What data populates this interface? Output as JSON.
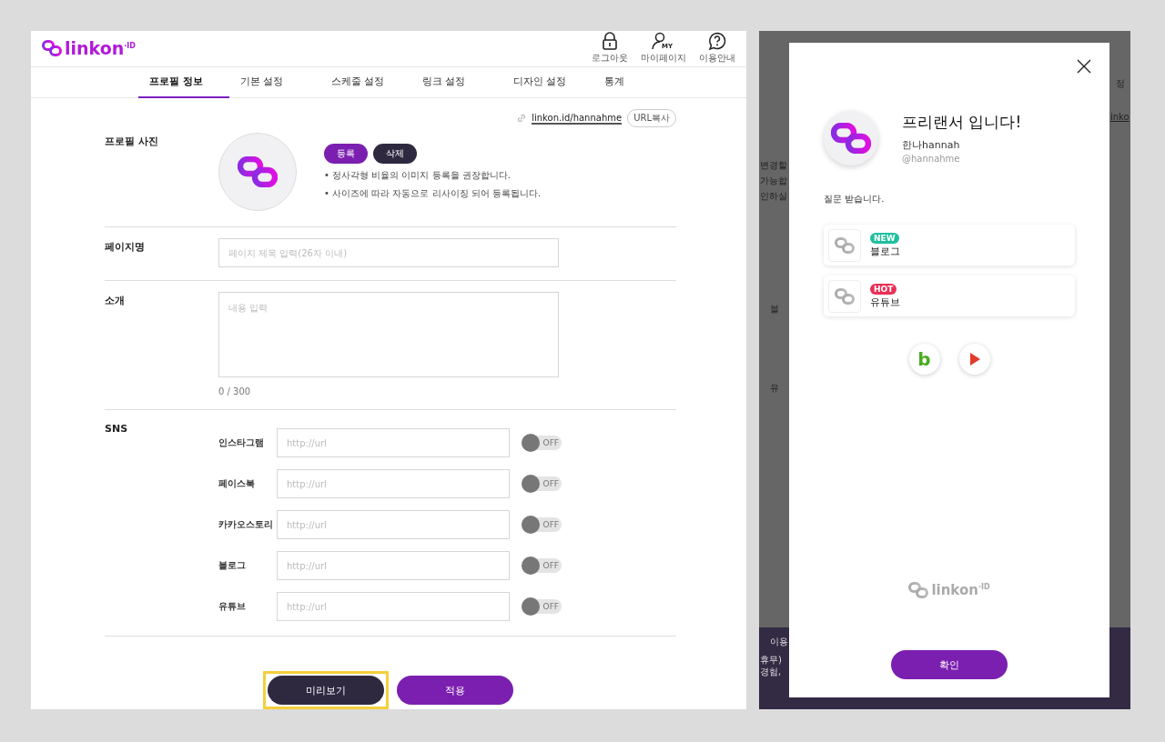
{
  "editor": {
    "logo": {
      "text": "linkon",
      "superscript": "·ID"
    },
    "header_actions": [
      {
        "label": "로그아웃",
        "kind": "lock"
      },
      {
        "label": "마이페이지",
        "kind": "my",
        "icon_text": "MY"
      },
      {
        "label": "이용안내",
        "kind": "help"
      }
    ],
    "tabs": [
      {
        "label": "프로필 정보",
        "selected": true
      },
      {
        "label": "기본 설정",
        "selected": false
      },
      {
        "label": "스케줄 설정",
        "selected": false
      },
      {
        "label": "링크 설정",
        "selected": false
      },
      {
        "label": "디자인 설정",
        "selected": false
      },
      {
        "label": "통계",
        "selected": false
      }
    ],
    "profile_link": {
      "url": "linkon.id/hannahme",
      "copy_button": "URL복사"
    },
    "profile_photo": {
      "label": "프로필 사진",
      "buttons": [
        {
          "label": "등록",
          "kind": "primary"
        },
        {
          "label": "삭제",
          "kind": "dark"
        }
      ],
      "notes": [
        "• 정사각형 비율의 이미지 등록을 권장합니다.",
        "• 사이즈에 따라 자동으로 리사이징 되어 등록됩니다."
      ]
    },
    "page_name": {
      "label": "페이지명",
      "placeholder": "페이지 제목 입력(26자 이내)"
    },
    "intro": {
      "label": "소개",
      "placeholder": "내용 입력",
      "counter": "0 / 300"
    },
    "sns": {
      "label": "SNS",
      "items": [
        {
          "name": "인스타그램",
          "placeholder": "http://url",
          "on": false,
          "toggle_text": "OFF"
        },
        {
          "name": "페이스북",
          "placeholder": "http://url",
          "on": false,
          "toggle_text": "OFF"
        },
        {
          "name": "카카오스토리",
          "placeholder": "http://url",
          "on": false,
          "toggle_text": "OFF"
        },
        {
          "name": "블로그",
          "placeholder": "http://url",
          "on": false,
          "toggle_text": "OFF"
        },
        {
          "name": "유튜브",
          "placeholder": "http://url",
          "on": false,
          "toggle_text": "OFF"
        }
      ]
    },
    "actions": [
      {
        "label": "미리보기",
        "kind": "dark",
        "highlighted": true
      },
      {
        "label": "적용",
        "kind": "primary",
        "highlighted": false
      }
    ]
  },
  "preview": {
    "background_left": [
      "변경할",
      "가능합",
      "인하실",
      "블",
      "유",
      "이용",
      "휴무)",
      "경험,"
    ],
    "background_right": [
      "정",
      "inko"
    ],
    "modal": {
      "title": "프리랜서 입니다!",
      "name": "한나hannah",
      "handle": "@hannahme",
      "message": "질문 받습니다.",
      "links": [
        {
          "badge": "NEW",
          "color": "#1dbf9f",
          "title": "블로그"
        },
        {
          "badge": "HOT",
          "color": "#ea2f55",
          "title": "유튜브"
        }
      ],
      "socials": [
        {
          "kind": "blog",
          "letter": "b"
        },
        {
          "kind": "youtube"
        }
      ],
      "footer_logo": {
        "text": "linkon",
        "superscript": "·ID"
      },
      "confirm": "확인"
    }
  }
}
